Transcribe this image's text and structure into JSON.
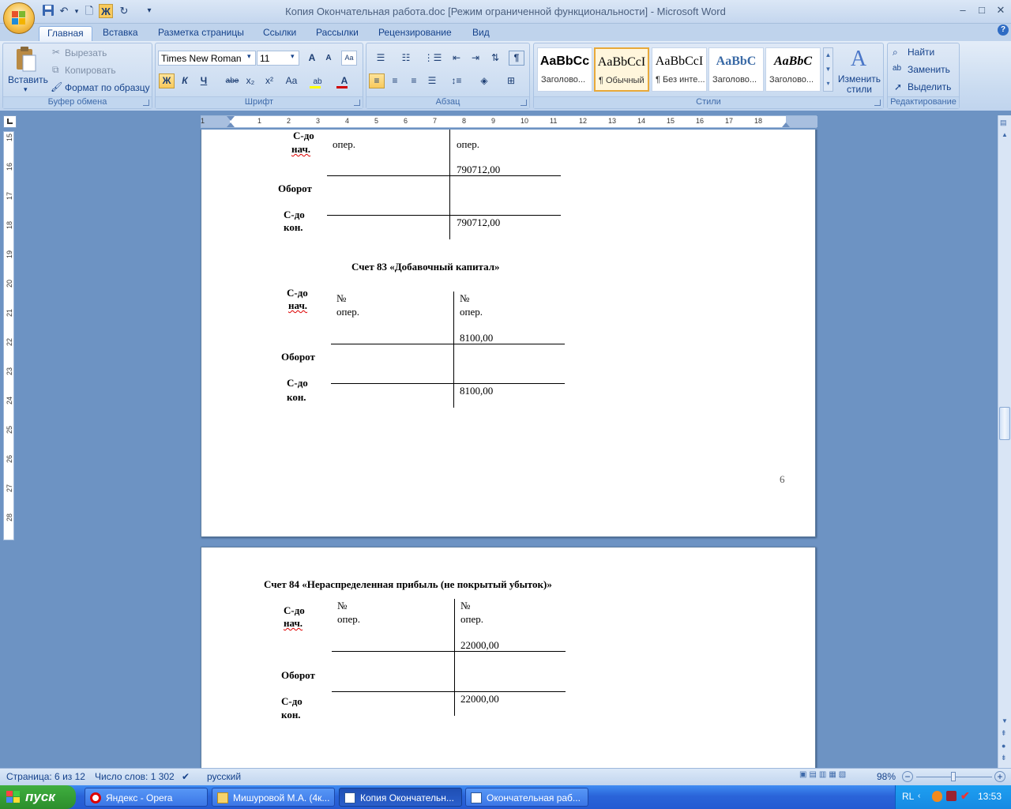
{
  "window": {
    "title": "Копия Окончательная работа.doc [Режим ограниченной функциональности] - Microsoft Word",
    "controls": [
      "–",
      "□",
      "✕"
    ]
  },
  "tabs": [
    "Главная",
    "Вставка",
    "Разметка страницы",
    "Ссылки",
    "Рассылки",
    "Рецензирование",
    "Вид"
  ],
  "ribbon": {
    "clipboard": {
      "label": "Буфер обмена",
      "paste": "Вставить",
      "cut": "Вырезать",
      "copy": "Копировать",
      "format_painter": "Формат по образцу"
    },
    "font": {
      "label": "Шрифт",
      "name": "Times New Roman",
      "size": "11",
      "bold": "Ж",
      "italic": "К",
      "underline": "Ч",
      "strike": "abe",
      "sub": "x₂",
      "sup": "x²",
      "case": "Aa",
      "grow": "A",
      "shrink": "A",
      "highlight_color": "#ffff00",
      "font_color": "#d00000"
    },
    "paragraph": {
      "label": "Абзац"
    },
    "styles": {
      "label": "Стили",
      "tiles": [
        {
          "sample": "AaBbCc",
          "name": "Заголово..."
        },
        {
          "sample": "AaBbCcI",
          "name": "¶ Обычный"
        },
        {
          "sample": "AaBbCcI",
          "name": "¶ Без инте..."
        },
        {
          "sample": "AaBbC",
          "name": "Заголово..."
        },
        {
          "sample": "AaBbC",
          "name": "Заголово..."
        }
      ],
      "change_styles": "Изменить стили"
    },
    "editing": {
      "label": "Редактирование",
      "find": "Найти",
      "replace": "Заменить",
      "select": "Выделить"
    }
  },
  "ruler": {
    "top_numbers": [
      "1",
      "1",
      "2",
      "3",
      "4",
      "5",
      "6",
      "7",
      "8",
      "9",
      "10",
      "11",
      "12",
      "13",
      "14",
      "15",
      "16",
      "17",
      "18"
    ],
    "left_numbers": [
      "15",
      "16",
      "17",
      "18",
      "19",
      "20",
      "21",
      "22",
      "23",
      "24",
      "25",
      "26",
      "27",
      "28"
    ]
  },
  "document": {
    "page6": {
      "top_table": {
        "opening_label": "С-до",
        "opening_label2": "нач.",
        "debit_head": "опер.",
        "credit_head": "опер.",
        "credit_opening": "790712,00",
        "turnover": "Оборот",
        "closing_label": "С-до",
        "closing_label2": "кон.",
        "credit_closing": "790712,00"
      },
      "account83": {
        "title": "Счет 83 «Добавочный капитал»",
        "opening_label": "С-до",
        "opening_label2": "нач.",
        "debit_no": "№",
        "debit_head": "опер.",
        "credit_no": "№",
        "credit_head": "опер.",
        "credit_opening": "8100,00",
        "turnover": "Оборот",
        "closing_label": "С-до",
        "closing_label2": "кон.",
        "credit_closing": "8100,00"
      },
      "page_number": "6"
    },
    "page7": {
      "account84": {
        "title": "Счет 84 «Нераспределенная  прибыль (не покрытый убыток)»",
        "opening_label": "С-до",
        "opening_label2": "нач.",
        "debit_no": "№",
        "debit_head": "опер.",
        "credit_no": "№",
        "credit_head": "опер.",
        "credit_opening": "22000,00",
        "turnover": "Оборот",
        "closing_label": "С-до",
        "closing_label2": "кон.",
        "credit_closing": "22000,00"
      }
    }
  },
  "status": {
    "page": "Страница: 6 из 12",
    "words": "Число слов: 1 302",
    "language": "русский",
    "zoom": "98%"
  },
  "taskbar": {
    "start": "пуск",
    "tasks": [
      "Яндекс - Opera",
      "Мишуровой М.А. (4к...",
      "Копия Окончательн...",
      "Окончательная раб..."
    ],
    "lang": "RL",
    "time": "13:53"
  }
}
